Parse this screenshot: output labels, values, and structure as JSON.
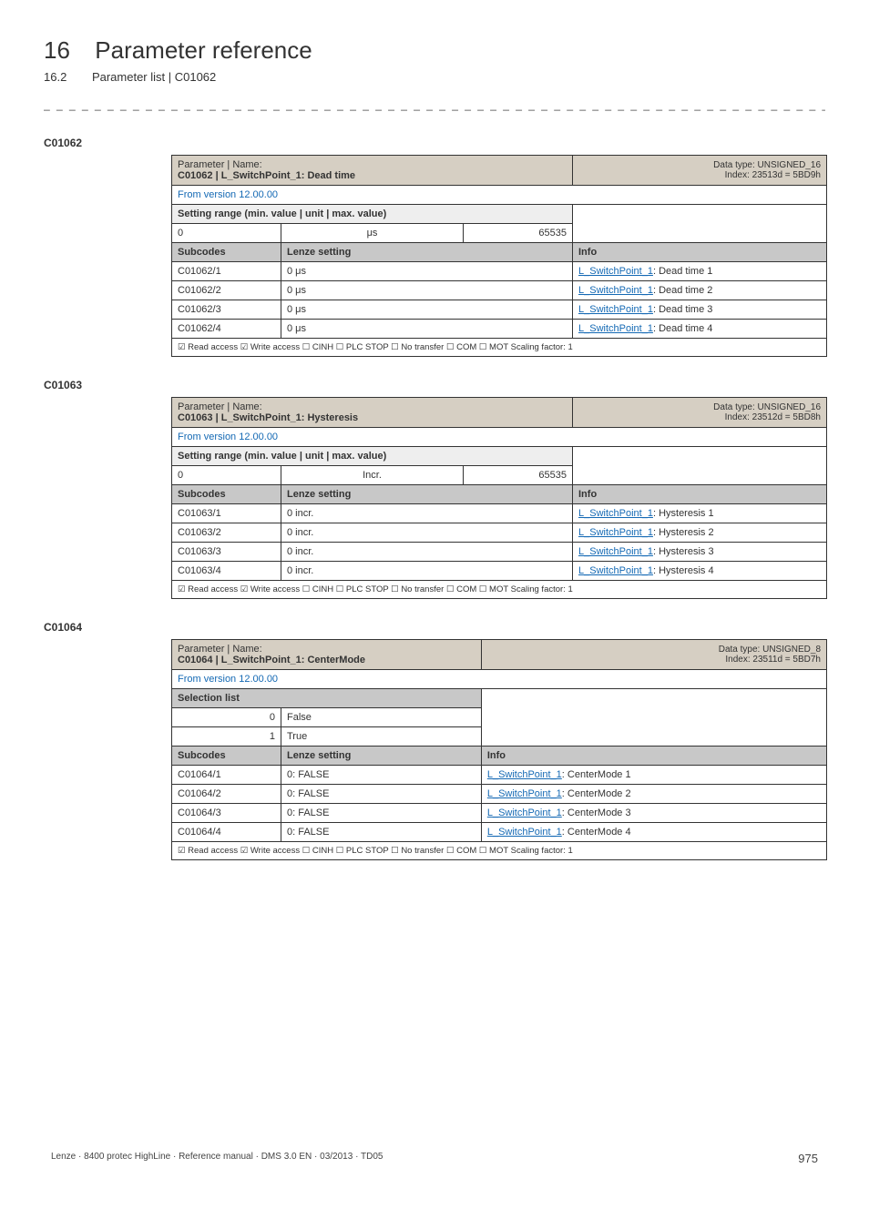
{
  "chapter": {
    "num": "16",
    "title": "Parameter reference"
  },
  "subchapter": {
    "num": "16.2",
    "title": "Parameter list | C01062"
  },
  "dashline": "_ _ _ _ _ _ _ _ _ _ _ _ _ _ _ _ _ _ _ _ _ _ _ _ _ _ _ _ _ _ _ _ _ _ _ _ _ _ _ _ _ _ _ _ _ _ _ _ _ _ _ _ _ _ _ _ _ _ _ _ _ _ _ _ _ _",
  "tables": [
    {
      "id": "C01062",
      "param_label": "Parameter | Name:",
      "param_name": "C01062 | L_SwitchPoint_1: Dead time",
      "dtype1": "Data type: UNSIGNED_16",
      "dtype2": "Index: 23513d = 5BD9h",
      "version": "From version 12.00.00",
      "range_header": "Setting range (min. value | unit | max. value)",
      "range_min": "0",
      "range_unit": "μs",
      "range_max": "65535",
      "subcodes_h1": "Subcodes",
      "subcodes_h2": "Lenze setting",
      "subcodes_h3": "Info",
      "rows": [
        {
          "c": "C01062/1",
          "s": "0 μs",
          "link": "L_SwitchPoint_1",
          "tail": ": Dead time 1"
        },
        {
          "c": "C01062/2",
          "s": "0 μs",
          "link": "L_SwitchPoint_1",
          "tail": ": Dead time 2"
        },
        {
          "c": "C01062/3",
          "s": "0 μs",
          "link": "L_SwitchPoint_1",
          "tail": ": Dead time 3"
        },
        {
          "c": "C01062/4",
          "s": "0 μs",
          "link": "L_SwitchPoint_1",
          "tail": ": Dead time 4"
        }
      ],
      "access": "☑ Read access   ☑ Write access   ☐ CINH   ☐ PLC STOP   ☐ No transfer   ☐ COM   ☐ MOT    Scaling factor: 1"
    },
    {
      "id": "C01063",
      "param_label": "Parameter | Name:",
      "param_name": "C01063 | L_SwitchPoint_1: Hysteresis",
      "dtype1": "Data type: UNSIGNED_16",
      "dtype2": "Index: 23512d = 5BD8h",
      "version": "From version 12.00.00",
      "range_header": "Setting range (min. value | unit | max. value)",
      "range_min": "0",
      "range_unit": "Incr.",
      "range_max": "65535",
      "subcodes_h1": "Subcodes",
      "subcodes_h2": "Lenze setting",
      "subcodes_h3": "Info",
      "rows": [
        {
          "c": "C01063/1",
          "s": "0 incr.",
          "link": "L_SwitchPoint_1",
          "tail": ": Hysteresis 1"
        },
        {
          "c": "C01063/2",
          "s": "0 incr.",
          "link": "L_SwitchPoint_1",
          "tail": ": Hysteresis 2"
        },
        {
          "c": "C01063/3",
          "s": "0 incr.",
          "link": "L_SwitchPoint_1",
          "tail": ": Hysteresis 3"
        },
        {
          "c": "C01063/4",
          "s": "0 incr.",
          "link": "L_SwitchPoint_1",
          "tail": ": Hysteresis 4"
        }
      ],
      "access": "☑ Read access   ☑ Write access   ☐ CINH   ☐ PLC STOP   ☐ No transfer   ☐ COM   ☐ MOT    Scaling factor: 1"
    },
    {
      "id": "C01064",
      "param_label": "Parameter | Name:",
      "param_name": "C01064 | L_SwitchPoint_1: CenterMode",
      "dtype1": "Data type: UNSIGNED_8",
      "dtype2": "Index: 23511d = 5BD7h",
      "version": "From version 12.00.00",
      "sel_header": "Selection list",
      "options": [
        {
          "v": "0",
          "t": "False"
        },
        {
          "v": "1",
          "t": "True"
        }
      ],
      "subcodes_h1": "Subcodes",
      "subcodes_h2": "Lenze setting",
      "subcodes_h3": "Info",
      "rows": [
        {
          "c": "C01064/1",
          "s": "0: FALSE",
          "link": "L_SwitchPoint_1",
          "tail": ": CenterMode 1"
        },
        {
          "c": "C01064/2",
          "s": "0: FALSE",
          "link": "L_SwitchPoint_1",
          "tail": ": CenterMode 2"
        },
        {
          "c": "C01064/3",
          "s": "0: FALSE",
          "link": "L_SwitchPoint_1",
          "tail": ": CenterMode 3"
        },
        {
          "c": "C01064/4",
          "s": "0: FALSE",
          "link": "L_SwitchPoint_1",
          "tail": ": CenterMode 4"
        }
      ],
      "access": "☑ Read access   ☑ Write access   ☐ CINH   ☐ PLC STOP   ☐ No transfer   ☐ COM   ☐ MOT    Scaling factor: 1"
    }
  ],
  "footer": {
    "left": "Lenze · 8400 protec HighLine · Reference manual · DMS 3.0 EN · 03/2013 · TD05",
    "page": "975"
  }
}
